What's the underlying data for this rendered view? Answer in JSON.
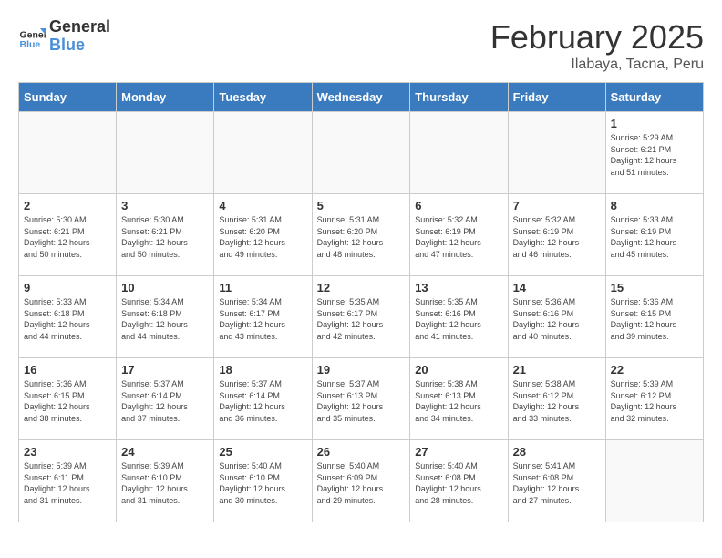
{
  "logo": {
    "text_general": "General",
    "text_blue": "Blue"
  },
  "header": {
    "month": "February 2025",
    "location": "Ilabaya, Tacna, Peru"
  },
  "days_of_week": [
    "Sunday",
    "Monday",
    "Tuesday",
    "Wednesday",
    "Thursday",
    "Friday",
    "Saturday"
  ],
  "weeks": [
    [
      {
        "day": "",
        "info": ""
      },
      {
        "day": "",
        "info": ""
      },
      {
        "day": "",
        "info": ""
      },
      {
        "day": "",
        "info": ""
      },
      {
        "day": "",
        "info": ""
      },
      {
        "day": "",
        "info": ""
      },
      {
        "day": "1",
        "info": "Sunrise: 5:29 AM\nSunset: 6:21 PM\nDaylight: 12 hours\nand 51 minutes."
      }
    ],
    [
      {
        "day": "2",
        "info": "Sunrise: 5:30 AM\nSunset: 6:21 PM\nDaylight: 12 hours\nand 50 minutes."
      },
      {
        "day": "3",
        "info": "Sunrise: 5:30 AM\nSunset: 6:21 PM\nDaylight: 12 hours\nand 50 minutes."
      },
      {
        "day": "4",
        "info": "Sunrise: 5:31 AM\nSunset: 6:20 PM\nDaylight: 12 hours\nand 49 minutes."
      },
      {
        "day": "5",
        "info": "Sunrise: 5:31 AM\nSunset: 6:20 PM\nDaylight: 12 hours\nand 48 minutes."
      },
      {
        "day": "6",
        "info": "Sunrise: 5:32 AM\nSunset: 6:19 PM\nDaylight: 12 hours\nand 47 minutes."
      },
      {
        "day": "7",
        "info": "Sunrise: 5:32 AM\nSunset: 6:19 PM\nDaylight: 12 hours\nand 46 minutes."
      },
      {
        "day": "8",
        "info": "Sunrise: 5:33 AM\nSunset: 6:19 PM\nDaylight: 12 hours\nand 45 minutes."
      }
    ],
    [
      {
        "day": "9",
        "info": "Sunrise: 5:33 AM\nSunset: 6:18 PM\nDaylight: 12 hours\nand 44 minutes."
      },
      {
        "day": "10",
        "info": "Sunrise: 5:34 AM\nSunset: 6:18 PM\nDaylight: 12 hours\nand 44 minutes."
      },
      {
        "day": "11",
        "info": "Sunrise: 5:34 AM\nSunset: 6:17 PM\nDaylight: 12 hours\nand 43 minutes."
      },
      {
        "day": "12",
        "info": "Sunrise: 5:35 AM\nSunset: 6:17 PM\nDaylight: 12 hours\nand 42 minutes."
      },
      {
        "day": "13",
        "info": "Sunrise: 5:35 AM\nSunset: 6:16 PM\nDaylight: 12 hours\nand 41 minutes."
      },
      {
        "day": "14",
        "info": "Sunrise: 5:36 AM\nSunset: 6:16 PM\nDaylight: 12 hours\nand 40 minutes."
      },
      {
        "day": "15",
        "info": "Sunrise: 5:36 AM\nSunset: 6:15 PM\nDaylight: 12 hours\nand 39 minutes."
      }
    ],
    [
      {
        "day": "16",
        "info": "Sunrise: 5:36 AM\nSunset: 6:15 PM\nDaylight: 12 hours\nand 38 minutes."
      },
      {
        "day": "17",
        "info": "Sunrise: 5:37 AM\nSunset: 6:14 PM\nDaylight: 12 hours\nand 37 minutes."
      },
      {
        "day": "18",
        "info": "Sunrise: 5:37 AM\nSunset: 6:14 PM\nDaylight: 12 hours\nand 36 minutes."
      },
      {
        "day": "19",
        "info": "Sunrise: 5:37 AM\nSunset: 6:13 PM\nDaylight: 12 hours\nand 35 minutes."
      },
      {
        "day": "20",
        "info": "Sunrise: 5:38 AM\nSunset: 6:13 PM\nDaylight: 12 hours\nand 34 minutes."
      },
      {
        "day": "21",
        "info": "Sunrise: 5:38 AM\nSunset: 6:12 PM\nDaylight: 12 hours\nand 33 minutes."
      },
      {
        "day": "22",
        "info": "Sunrise: 5:39 AM\nSunset: 6:12 PM\nDaylight: 12 hours\nand 32 minutes."
      }
    ],
    [
      {
        "day": "23",
        "info": "Sunrise: 5:39 AM\nSunset: 6:11 PM\nDaylight: 12 hours\nand 31 minutes."
      },
      {
        "day": "24",
        "info": "Sunrise: 5:39 AM\nSunset: 6:10 PM\nDaylight: 12 hours\nand 31 minutes."
      },
      {
        "day": "25",
        "info": "Sunrise: 5:40 AM\nSunset: 6:10 PM\nDaylight: 12 hours\nand 30 minutes."
      },
      {
        "day": "26",
        "info": "Sunrise: 5:40 AM\nSunset: 6:09 PM\nDaylight: 12 hours\nand 29 minutes."
      },
      {
        "day": "27",
        "info": "Sunrise: 5:40 AM\nSunset: 6:08 PM\nDaylight: 12 hours\nand 28 minutes."
      },
      {
        "day": "28",
        "info": "Sunrise: 5:41 AM\nSunset: 6:08 PM\nDaylight: 12 hours\nand 27 minutes."
      },
      {
        "day": "",
        "info": ""
      }
    ]
  ]
}
